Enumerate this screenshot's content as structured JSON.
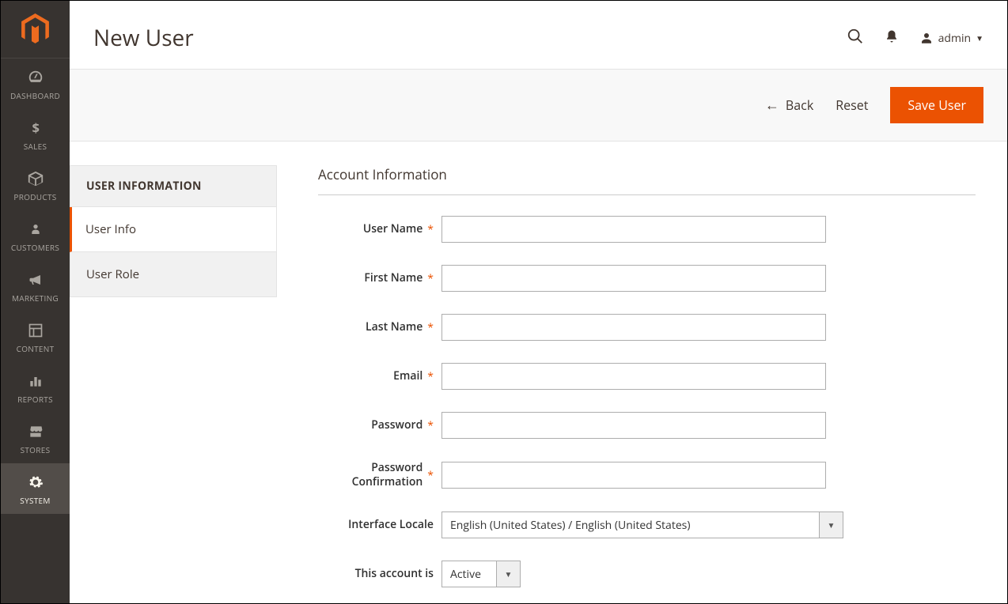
{
  "sidebar": {
    "items": [
      {
        "label": "DASHBOARD"
      },
      {
        "label": "SALES"
      },
      {
        "label": "PRODUCTS"
      },
      {
        "label": "CUSTOMERS"
      },
      {
        "label": "MARKETING"
      },
      {
        "label": "CONTENT"
      },
      {
        "label": "REPORTS"
      },
      {
        "label": "STORES"
      },
      {
        "label": "SYSTEM"
      }
    ]
  },
  "header": {
    "title": "New User",
    "admin_label": "admin"
  },
  "actions": {
    "back": "Back",
    "reset": "Reset",
    "save": "Save User"
  },
  "tabs": {
    "header": "USER INFORMATION",
    "items": [
      {
        "label": "User Info"
      },
      {
        "label": "User Role"
      }
    ]
  },
  "form": {
    "section_title": "Account Information",
    "fields": {
      "username": {
        "label": "User Name",
        "value": ""
      },
      "firstname": {
        "label": "First Name",
        "value": ""
      },
      "lastname": {
        "label": "Last Name",
        "value": ""
      },
      "email": {
        "label": "Email",
        "value": ""
      },
      "password": {
        "label": "Password",
        "value": ""
      },
      "password_confirm": {
        "label": "Password Confirmation",
        "value": ""
      },
      "locale": {
        "label": "Interface Locale",
        "value": "English (United States) / English (United States)"
      },
      "account_is": {
        "label": "This account is",
        "value": "Active"
      }
    }
  }
}
